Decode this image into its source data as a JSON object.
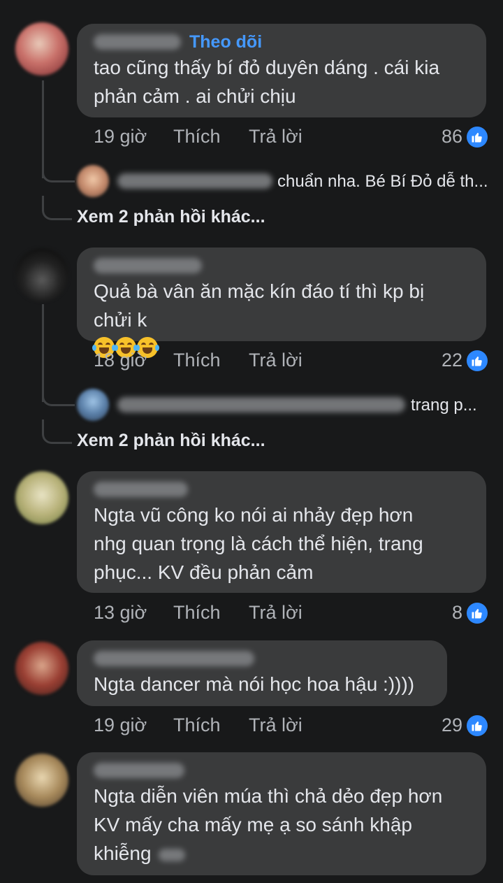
{
  "colors": {
    "background": "#18191a",
    "bubble": "#3a3b3c",
    "follow": "#4599ff",
    "like": "#2d88ff",
    "meta": "#b0b3b8"
  },
  "comments": [
    {
      "follow_label": "Theo dõi",
      "text": "tao cũng thấy bí đỏ duyên dáng . cái kia\nphản cảm . ai chửi chịu",
      "time": "19 giờ",
      "like_label": "Thích",
      "reply_label": "Trả lời",
      "reactions": "86",
      "reply_preview": "chuẩn nha. Bé Bí Đỏ dễ th...",
      "more_replies": "Xem 2 phản hồi khác..."
    },
    {
      "text": "Quả bà vân ăn mặc kín đáo tí thì kp bị\nchửi k",
      "emoji": "face-with-tears-of-joy x3",
      "time": "18 giờ",
      "like_label": "Thích",
      "reply_label": "Trả lời",
      "reactions": "22",
      "reply_preview": "trang p...",
      "more_replies": "Xem 2 phản hồi khác..."
    },
    {
      "text": "Ngta vũ công ko nói ai nhảy đẹp hơn\nnhg quan trọng là cách thể hiện, trang\nphục... KV đều phản cảm",
      "time": "13 giờ",
      "like_label": "Thích",
      "reply_label": "Trả lời",
      "reactions": "8"
    },
    {
      "text": "Ngta dancer mà nói học hoa hậu :))))",
      "time": "19 giờ",
      "like_label": "Thích",
      "reply_label": "Trả lời",
      "reactions": "29"
    },
    {
      "text": "Ngta diễn viên múa thì chả dẻo đẹp hơn\nKV mấy cha mấy mẹ ạ so sánh khập\nkhiễng"
    }
  ],
  "icons": {
    "like": "thumbs-up-icon",
    "emoji": "laughing-tears-emoji-icon"
  }
}
